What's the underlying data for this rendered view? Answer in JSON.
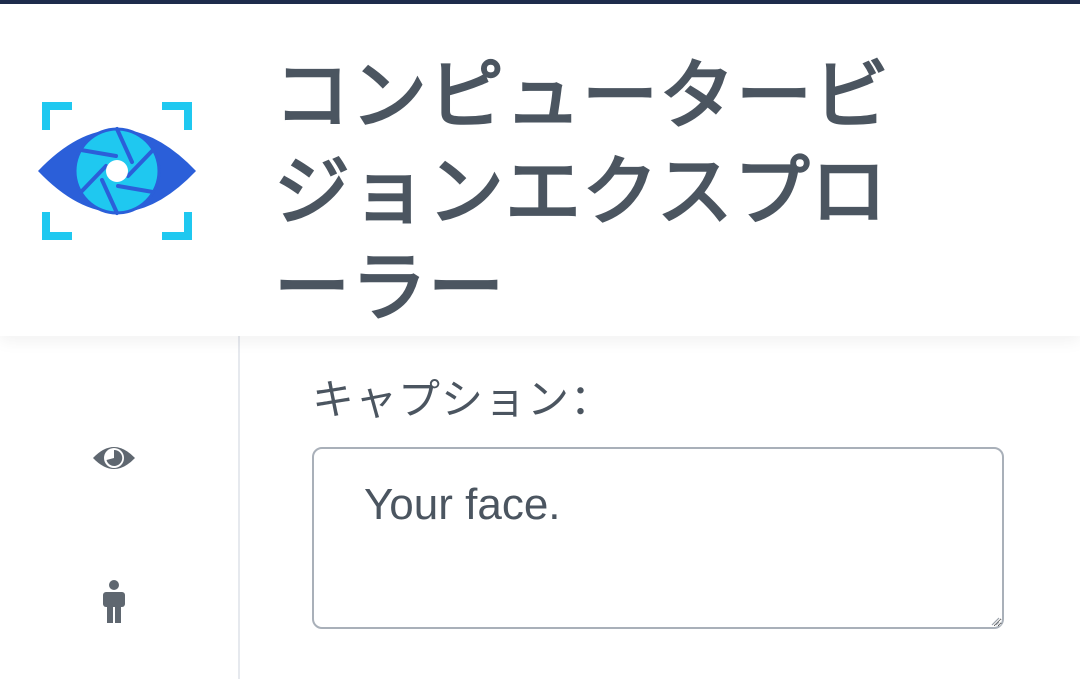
{
  "app": {
    "title": "コンピュータービジョンエクスプローラー",
    "accent_color": "#2b6cde",
    "accent_secondary": "#1fc8f0",
    "text_color": "#4b5560"
  },
  "header": {
    "logo_icon": "eye-aperture-logo-icon"
  },
  "sidebar": {
    "items": [
      {
        "id": "vision",
        "icon": "eye-icon"
      },
      {
        "id": "person",
        "icon": "person-icon"
      }
    ]
  },
  "caption": {
    "label": "キャプション：",
    "value": "Your face."
  }
}
